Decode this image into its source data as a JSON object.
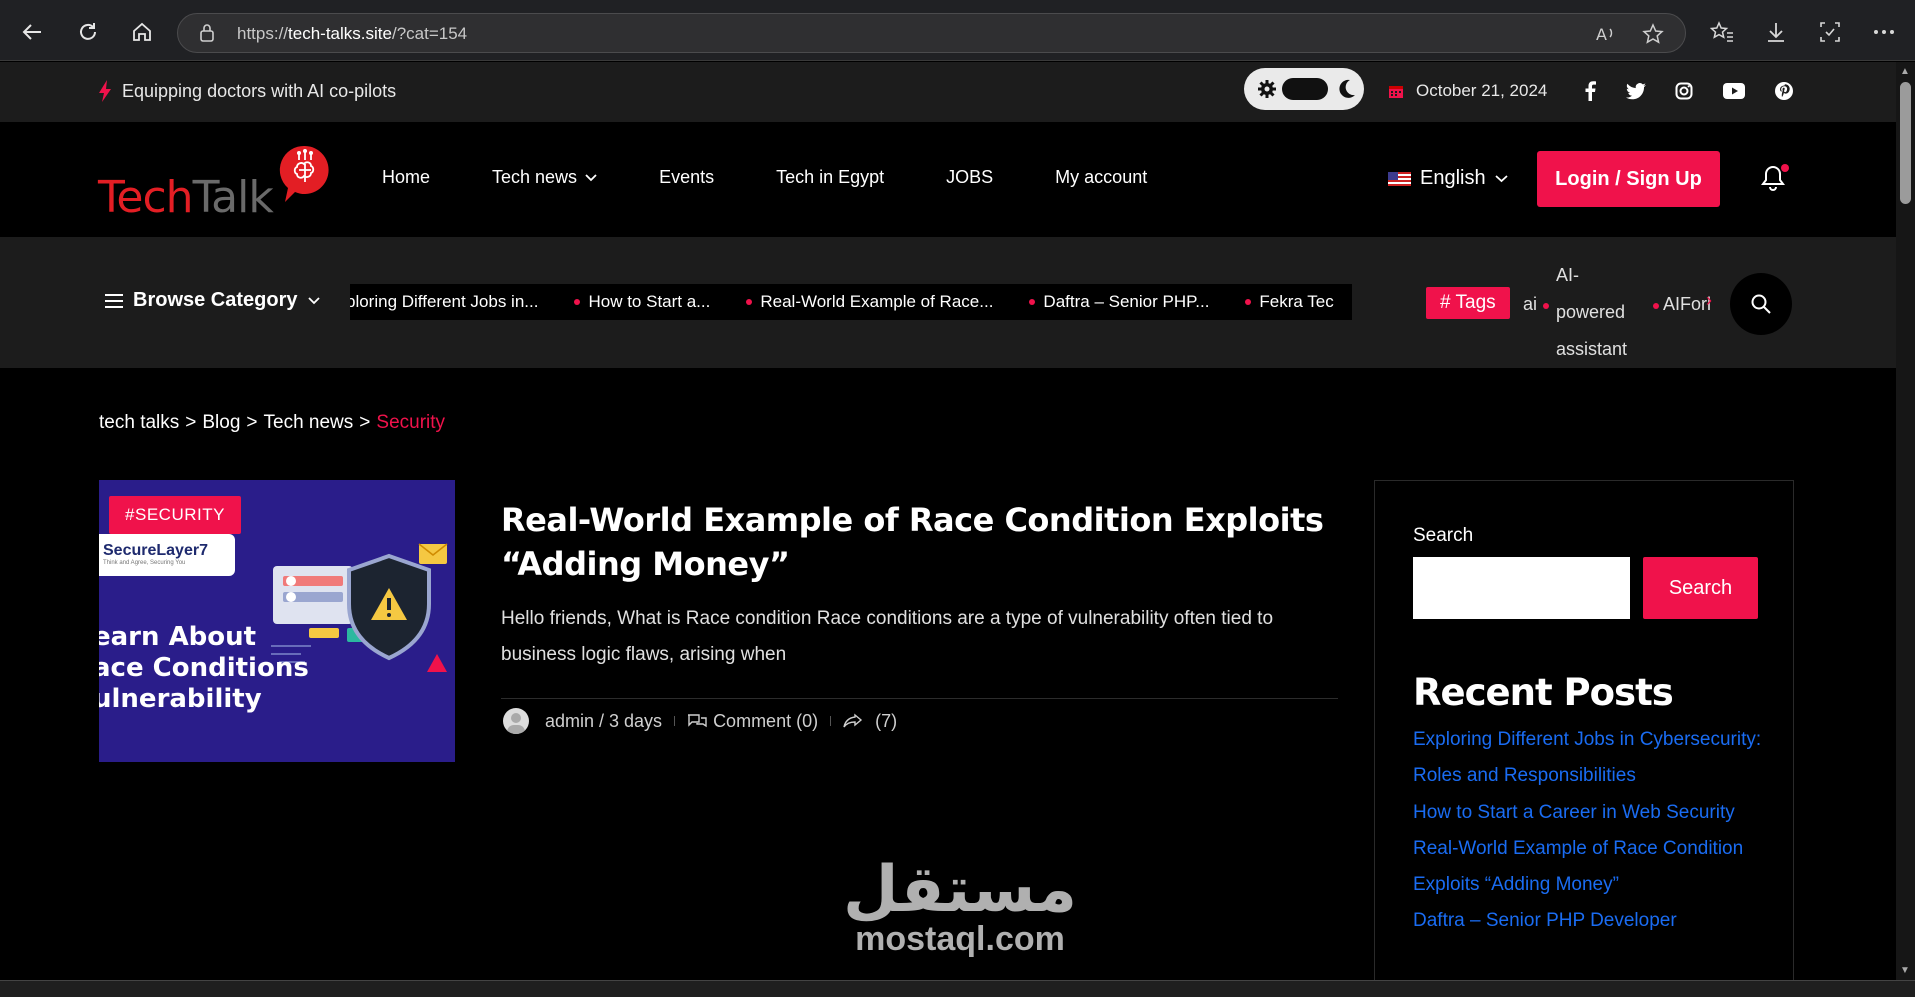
{
  "browser": {
    "url_prefix": "https://",
    "url_host": "tech-talks.site",
    "url_path": "/?cat=154"
  },
  "topbar": {
    "tagline": "Equipping doctors with AI co-pilots",
    "date": "October 21, 2024",
    "social_icons": [
      "facebook-icon",
      "twitter-icon",
      "instagram-icon",
      "youtube-icon",
      "pinterest-icon"
    ]
  },
  "header": {
    "logo_text_1": "Tech",
    "logo_text_2": "Talk",
    "nav": [
      "Home",
      "Tech news",
      "Events",
      "Tech in Egypt",
      "JOBS",
      "My account"
    ],
    "language": "English",
    "login_label": "Login / Sign Up"
  },
  "catbar": {
    "browse_label": "Browse Category",
    "ticker": [
      "ploring Different Jobs in...",
      "How to Start a...",
      "Real-World Example of Race...",
      "Daftra – Senior PHP...",
      "Fekra Tec"
    ],
    "tags_label": "# Tags",
    "tags": {
      "first": "ai",
      "second": "AI-powered assistant",
      "third": "AIForl"
    }
  },
  "breadcrumb": {
    "items": [
      "tech talks",
      ">",
      "Blog",
      ">",
      "Tech news",
      ">"
    ],
    "current": "Security"
  },
  "post": {
    "badge": "#SECURITY",
    "thumb_brand": "SecureLayer7",
    "thumb_brand_sub": "Think and Agree, Securing You",
    "thumb_headline": "earn About\nace Conditions\nulnerability",
    "title": "Real-World Example of Race Condition Exploits “Adding Money”",
    "excerpt": "Hello friends, What is Race condition Race conditions are a type of vulnerability often tied to business logic flaws, arising when",
    "author": "admin / 3 days",
    "comments": "Comment (0)",
    "shares": "(7)"
  },
  "sidebar": {
    "search_label": "Search",
    "search_button": "Search",
    "recent_title": "Recent Posts",
    "recent_posts": [
      "Exploring Different Jobs in Cybersecurity: Roles and Responsibilities",
      "How to Start a Career in Web Security",
      "Real-World Example of Race Condition Exploits “Adding Money”",
      "Daftra – Senior PHP Developer"
    ]
  },
  "watermark": {
    "arabic": "مستقل",
    "latin": "mostaql.com"
  },
  "colors": {
    "accent": "#f0124b",
    "link": "#1a6cf2",
    "bg": "#000000",
    "bar": "#1c1c1c"
  }
}
